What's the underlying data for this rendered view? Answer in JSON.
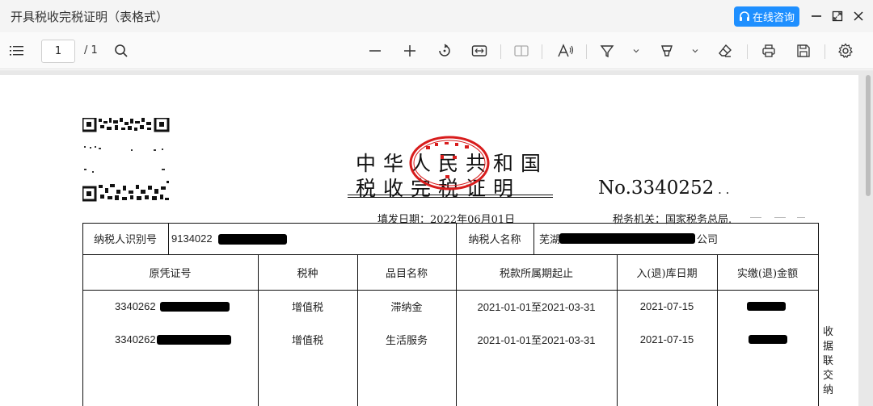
{
  "window": {
    "title": "开具税收完税证明（表格式）",
    "consult_button": "在线咨询"
  },
  "toolbar": {
    "page_current": "1",
    "page_total": "/ 1"
  },
  "certificate": {
    "title_line1": "中华人民共和国",
    "title_line2": "税收完税证明",
    "number": "No.3340252",
    "fill_date": "填发日期：2022年06月01日",
    "tax_office": "税务机关：国家税务总局",
    "taxpayer_id_label": "纳税人识别号",
    "taxpayer_id_value": "9134022",
    "taxpayer_name_label": "纳税人名称",
    "taxpayer_name_value_prefix": "芜湖",
    "taxpayer_name_value_suffix": "公司",
    "headers": [
      "原凭证号",
      "税种",
      "品目名称",
      "税款所属期起止",
      "入(退)库日期",
      "实缴(退)金额"
    ],
    "rows": [
      {
        "voucher": "3340262",
        "tax_type": "增值税",
        "item": "滞纳金",
        "period": "2021-01-01至2021-03-31",
        "date": "2021-07-15"
      },
      {
        "voucher": "3340262",
        "tax_type": "增值税",
        "item": "生活服务",
        "period": "2021-01-01至2021-03-31",
        "date": "2021-07-15"
      }
    ],
    "side_note": "收据联 交纳"
  }
}
